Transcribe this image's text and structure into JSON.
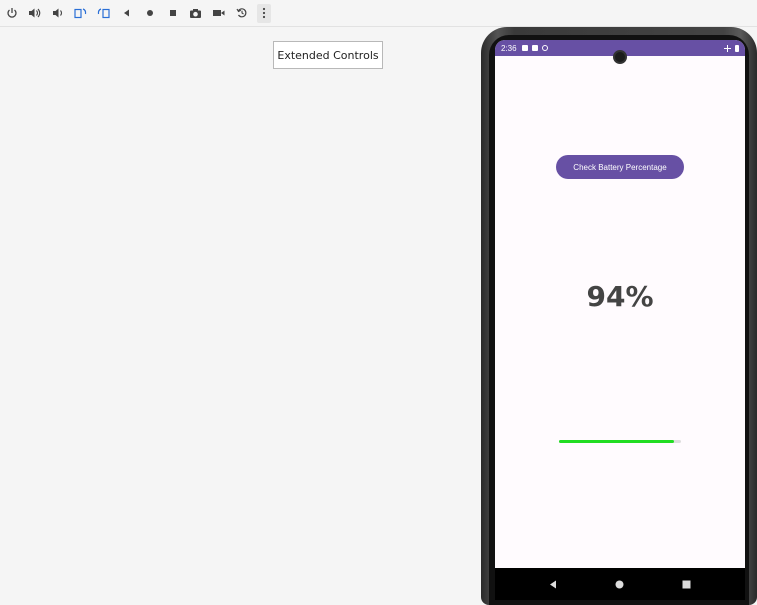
{
  "toolbar": {
    "items": [
      {
        "name": "power-icon"
      },
      {
        "name": "volume-up-icon"
      },
      {
        "name": "volume-down-icon"
      },
      {
        "name": "rotate-left-icon"
      },
      {
        "name": "rotate-right-icon"
      },
      {
        "name": "back-icon"
      },
      {
        "name": "home-icon"
      },
      {
        "name": "overview-icon"
      },
      {
        "name": "camera-icon"
      },
      {
        "name": "screenrecord-icon"
      },
      {
        "name": "snapshot-icon"
      },
      {
        "name": "more-icon"
      }
    ]
  },
  "extended_controls": {
    "label": "Extended Controls"
  },
  "phone": {
    "status_bar": {
      "time": "2:36",
      "color": "#6750a4"
    },
    "check_button": {
      "label": "Check Battery Percentage"
    },
    "battery": {
      "percentage_text": "94%",
      "progress": 0.94,
      "bar_color": "#22dd22"
    },
    "nav": {
      "back": "back-icon",
      "home": "home-icon",
      "recents": "recents-icon"
    }
  }
}
